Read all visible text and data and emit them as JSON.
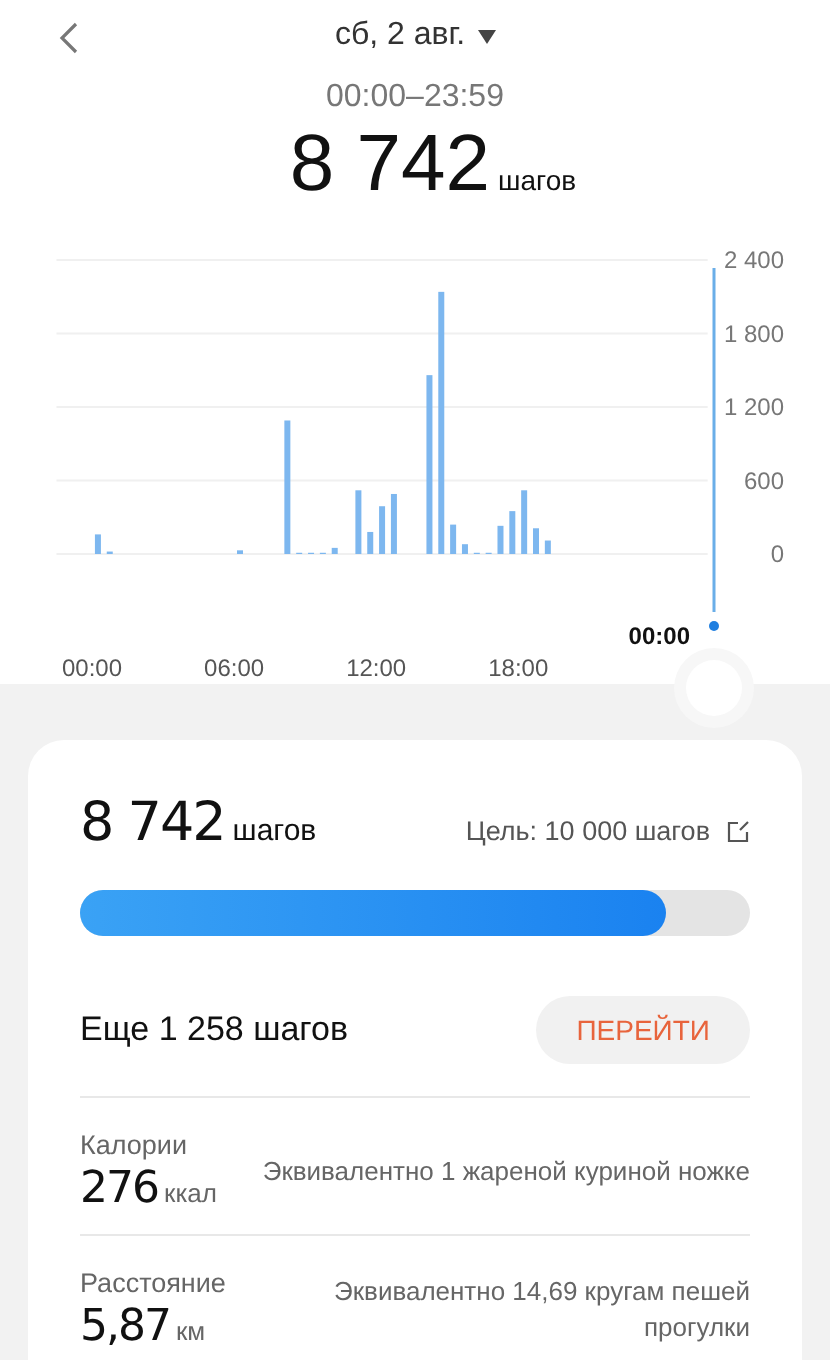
{
  "header": {
    "date": "сб, 2 авг.",
    "time_range": "00:00–23:59",
    "steps": "8 742",
    "steps_unit": "шагов"
  },
  "chart": {
    "cursor_label": "00:00",
    "chart_data": {
      "type": "bar",
      "x": [
        0.25,
        0.75,
        6.25,
        8.25,
        8.75,
        9.25,
        9.75,
        10.25,
        11.25,
        11.75,
        12.25,
        12.75,
        14.25,
        14.75,
        15.25,
        15.75,
        16.25,
        16.75,
        17.25,
        17.75,
        18.25,
        18.75,
        19.25
      ],
      "series": [
        {
          "color": "#7db7ef",
          "values": [
            160,
            20,
            30,
            1090,
            10,
            10,
            10,
            50,
            520,
            180,
            390,
            490,
            1460,
            2140,
            240,
            80,
            10,
            10,
            230,
            350,
            520,
            210,
            110
          ]
        }
      ],
      "xlim": [
        -1.5,
        26
      ],
      "ylim": [
        0,
        2400
      ],
      "grid": true,
      "yticks": [
        {
          "value": 0,
          "label": "0"
        },
        {
          "value": 600,
          "label": "600"
        },
        {
          "value": 1200,
          "label": "1 200"
        },
        {
          "value": 1800,
          "label": "1 800"
        },
        {
          "value": 2400,
          "label": "2 400"
        }
      ],
      "xticks": [
        {
          "value": 0,
          "label": "00:00"
        },
        {
          "value": 6,
          "label": "06:00"
        },
        {
          "value": 12,
          "label": "12:00"
        },
        {
          "value": 18,
          "label": "18:00"
        }
      ]
    }
  },
  "summary": {
    "steps": "8 742",
    "steps_unit": "шагов",
    "goal": "Цель: 10 000 шагов",
    "progress": {
      "level": 0.8742
    },
    "remaining": "Еще 1 258 шагов",
    "go_button": "ПЕРЕЙТИ"
  },
  "stats": [
    {
      "label": "Калории",
      "value": "276",
      "unit": "ккал",
      "equivalent": "Эквивалентно 1 жареной куриной ножке"
    },
    {
      "label": "Расстояние",
      "value": "5,87",
      "unit": "км",
      "equivalent": "Эквивалентно 14,69 кругам пешей прогулки"
    }
  ]
}
